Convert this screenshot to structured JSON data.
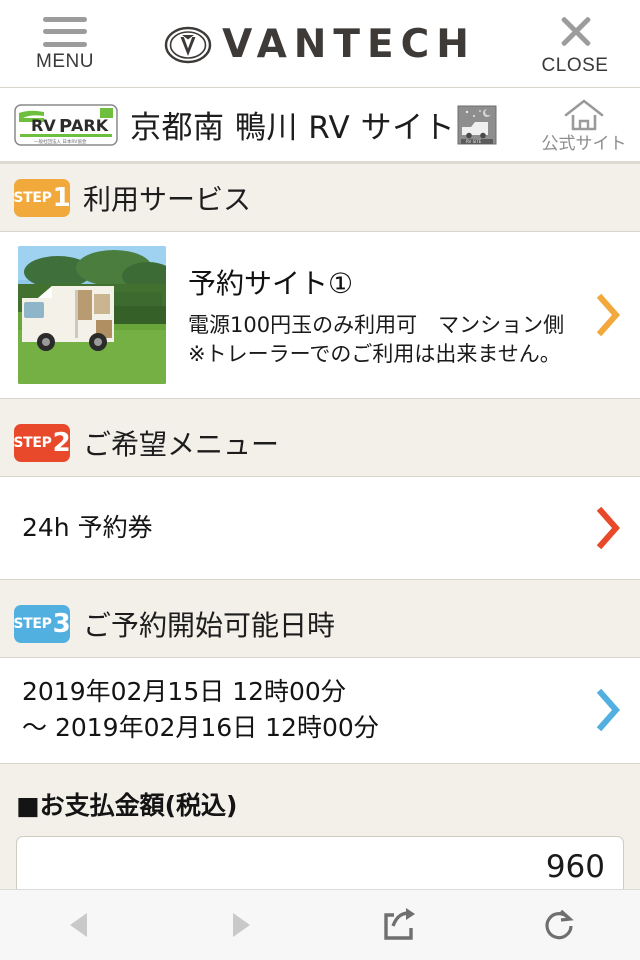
{
  "header": {
    "menu_label": "MENU",
    "close_label": "CLOSE",
    "brand": "VANTECH",
    "menu_icon": "hamburger-icon",
    "close_icon": "close-x-icon",
    "logo_icon": "vantech-v-oval-logo"
  },
  "sitebar": {
    "badge_text": "RV PARK",
    "badge_sub": "一般社団法人 日本RV協会",
    "title": "京都南 鴨川 RV サイト",
    "thumb_icon": "rv-night-thumbnail-icon",
    "official_label": "公式サイト",
    "official_icon": "home-icon"
  },
  "steps": [
    {
      "badge_label": "STEP",
      "badge_number": "1",
      "badge_color": "#f0a93a",
      "title": "利用サービス",
      "chevron_color": "#f0a93a",
      "type": "service",
      "photo_icon": "camper-van-photo",
      "service_name": "予約サイト①",
      "service_desc": "電源100円玉のみ利用可　マンション側　※トレーラーでのご利用は出来ません。"
    },
    {
      "badge_label": "STEP",
      "badge_number": "2",
      "badge_color": "#e8492a",
      "title": "ご希望メニュー",
      "chevron_color": "#e8492a",
      "type": "row",
      "row_text": "24h 予約券"
    },
    {
      "badge_label": "STEP",
      "badge_number": "3",
      "badge_color": "#52b0e0",
      "title": "ご予約開始可能日時",
      "chevron_color": "#52b0e0",
      "type": "row",
      "row_text_line1": "2019年02月15日 12時00分",
      "row_text_line2": "〜 2019年02月16日 12時00分"
    }
  ],
  "payment": {
    "label": "■お支払金額(税込)",
    "amount": "960"
  },
  "toolbar": {
    "back_icon": "back-triangle-icon",
    "forward_icon": "forward-triangle-icon",
    "share_icon": "share-icon",
    "reload_icon": "reload-icon",
    "disabled_color": "#c9c9c9",
    "active_color": "#6f6f6f"
  }
}
